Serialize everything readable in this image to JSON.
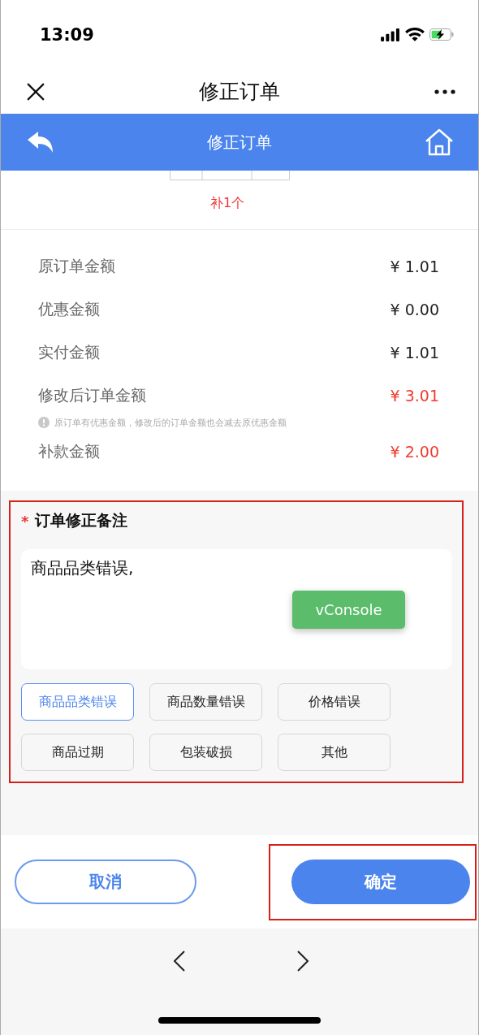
{
  "status_bar": {
    "time": "13:09"
  },
  "nav_bar": {
    "title": "修正订单"
  },
  "header": {
    "title": "修正订单"
  },
  "item": {
    "note": "补1个"
  },
  "amounts": [
    {
      "kind": "amount",
      "label": "原订单金额",
      "value": "¥ 1.01",
      "emphasis": false
    },
    {
      "kind": "amount",
      "label": "优惠金额",
      "value": "¥ 0.00",
      "emphasis": false
    },
    {
      "kind": "amount",
      "label": "实付金额",
      "value": "¥ 1.01",
      "emphasis": false
    },
    {
      "kind": "amount",
      "label": "修改后订单金额",
      "value": "¥ 3.01",
      "emphasis": true
    },
    {
      "kind": "note",
      "text": "原订单有优惠金额，修改后的订单金额也会减去原优惠金额"
    },
    {
      "kind": "amount",
      "label": "补款金额",
      "value": "¥ 2.00",
      "emphasis": true
    }
  ],
  "remarks": {
    "required_mark": "*",
    "title": "订单修正备注",
    "value": "商品品类错误,",
    "highlighted": true,
    "tags": [
      {
        "label": "商品品类错误",
        "selected": true
      },
      {
        "label": "商品数量错误",
        "selected": false
      },
      {
        "label": "价格错误",
        "selected": false
      },
      {
        "label": "商品过期",
        "selected": false
      },
      {
        "label": "包装破损",
        "selected": false
      },
      {
        "label": "其他",
        "selected": false
      }
    ]
  },
  "vconsole": {
    "label": "vConsole"
  },
  "actions": [
    {
      "kind": "secondary",
      "label": "取消",
      "highlighted": false
    },
    {
      "kind": "primary",
      "label": "确定",
      "highlighted": true
    }
  ]
}
